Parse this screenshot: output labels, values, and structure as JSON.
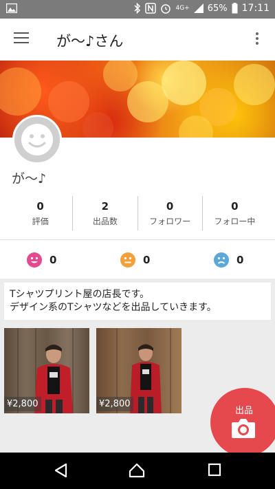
{
  "status_bar": {
    "network": "4G+",
    "battery": "65%",
    "time": "17:11"
  },
  "app_bar": {
    "title": "が〜♪さん"
  },
  "profile": {
    "username": "が〜♪",
    "stats": [
      {
        "value": "0",
        "label": "評価"
      },
      {
        "value": "2",
        "label": "出品数"
      },
      {
        "value": "0",
        "label": "フォロワー"
      },
      {
        "value": "0",
        "label": "フォロー中"
      }
    ],
    "ratings": [
      {
        "icon": "happy-face-icon",
        "count": "0",
        "color": "#e24b8f"
      },
      {
        "icon": "neutral-face-icon",
        "count": "0",
        "color": "#f2a13a"
      },
      {
        "icon": "sad-face-icon",
        "count": "0",
        "color": "#5aa7d8"
      }
    ],
    "bio_line1": "Tシャツプリント屋の店長です。",
    "bio_line2": "デザイン系のTシャツなどを出品していきます。"
  },
  "items": [
    {
      "price": "¥2,800"
    },
    {
      "price": "¥2,800"
    }
  ],
  "fab": {
    "label": "出品",
    "color": "#e5484d"
  },
  "colors": {
    "status_bar": "#7b7b7b",
    "background": "#ececec"
  }
}
